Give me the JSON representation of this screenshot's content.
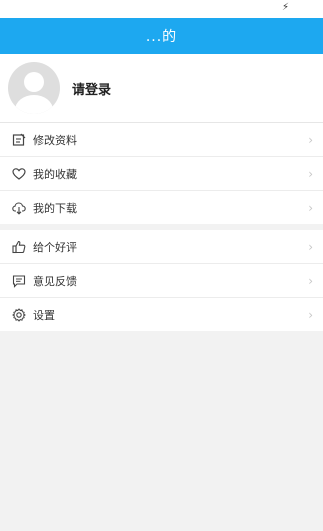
{
  "header": {
    "title": "...的"
  },
  "profile": {
    "login_label": "请登录"
  },
  "menu_group_1": [
    {
      "label": "修改资料",
      "icon": "edit-icon"
    },
    {
      "label": "我的收藏",
      "icon": "heart-icon"
    },
    {
      "label": "我的下载",
      "icon": "cloud-download-icon"
    }
  ],
  "menu_group_2": [
    {
      "label": "给个好评",
      "icon": "thumbs-up-icon"
    },
    {
      "label": "意见反馈",
      "icon": "message-icon"
    },
    {
      "label": "设置",
      "icon": "gear-icon"
    }
  ],
  "colors": {
    "accent": "#1da8f0",
    "background": "#f2f2f2"
  }
}
